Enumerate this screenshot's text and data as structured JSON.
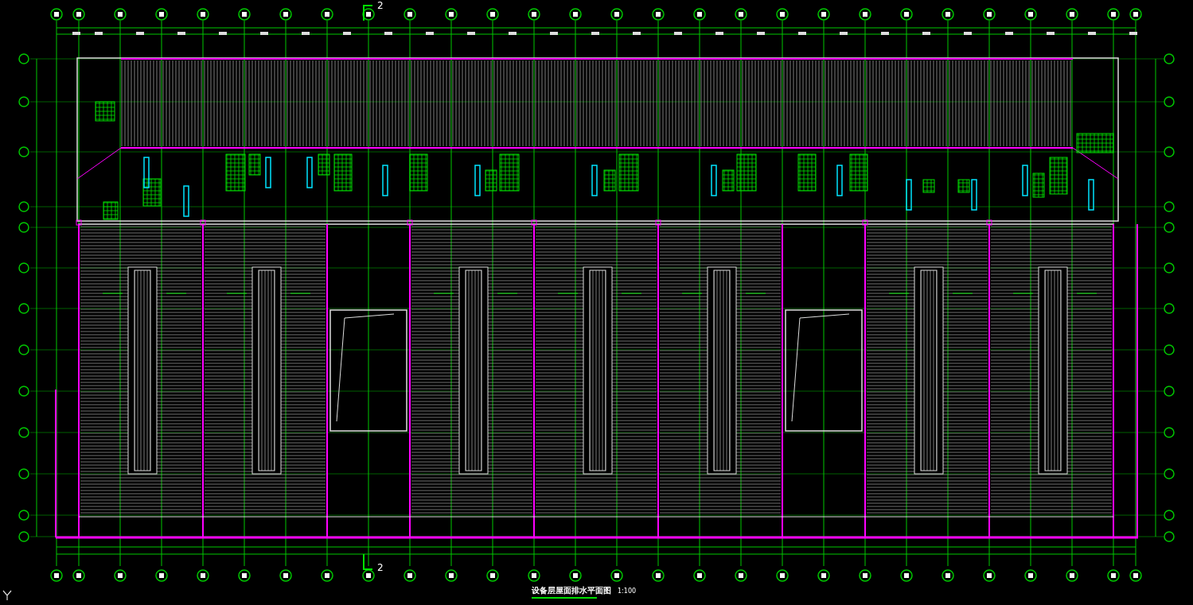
{
  "section_marks": [
    {
      "label": "2"
    },
    {
      "label": "2"
    }
  ],
  "title": "设备层屋面排水平面图",
  "scale": "1:100"
}
